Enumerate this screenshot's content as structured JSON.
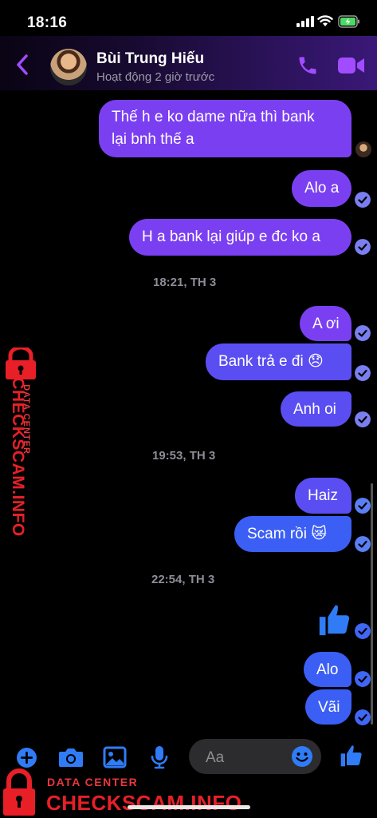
{
  "status_bar": {
    "time": "18:16"
  },
  "header": {
    "contact_name": "Bùi Trung Hiếu",
    "contact_status": "Hoạt động 2 giờ trước"
  },
  "messages": [
    {
      "text_line1": "Thế h e ko dame nữa thì bank",
      "text_line2": "lại bnh thế a"
    },
    {
      "text": "Alo a"
    },
    {
      "text": "H a bank lại giúp e đc ko a"
    },
    {
      "text": "A ơi"
    },
    {
      "text": "Bank trả e đi 😞"
    },
    {
      "text": "Anh oi"
    },
    {
      "text": "Haiz"
    },
    {
      "text": "Scam rồi 😿"
    },
    {
      "text": "Alo"
    },
    {
      "text": "Vãi"
    }
  ],
  "timestamps": [
    "18:21, TH 3",
    "19:53, TH 3",
    "22:54, TH 3"
  ],
  "composer": {
    "placeholder": "Aa"
  },
  "watermark": {
    "side_label": "DATA CENTER",
    "side_brand": "CHECKSCAM.INFO",
    "bottom_label": "DATA CENTER",
    "bottom_brand": "CHECKSCAM.INFO"
  },
  "colors": {
    "bubble_purple": "#7b3ff2",
    "bubble_mid": "#5a4ef2",
    "bubble_blue": "#3b5ff5",
    "accent": "#a24cff",
    "icon_blue": "#2f7cf6",
    "watermark_red": "#e81f27"
  },
  "icons": [
    "back-icon",
    "phone-icon",
    "video-call-icon",
    "plus-icon",
    "camera-icon",
    "gallery-icon",
    "microphone-icon",
    "emoji-icon",
    "like-icon",
    "lock-icon"
  ]
}
